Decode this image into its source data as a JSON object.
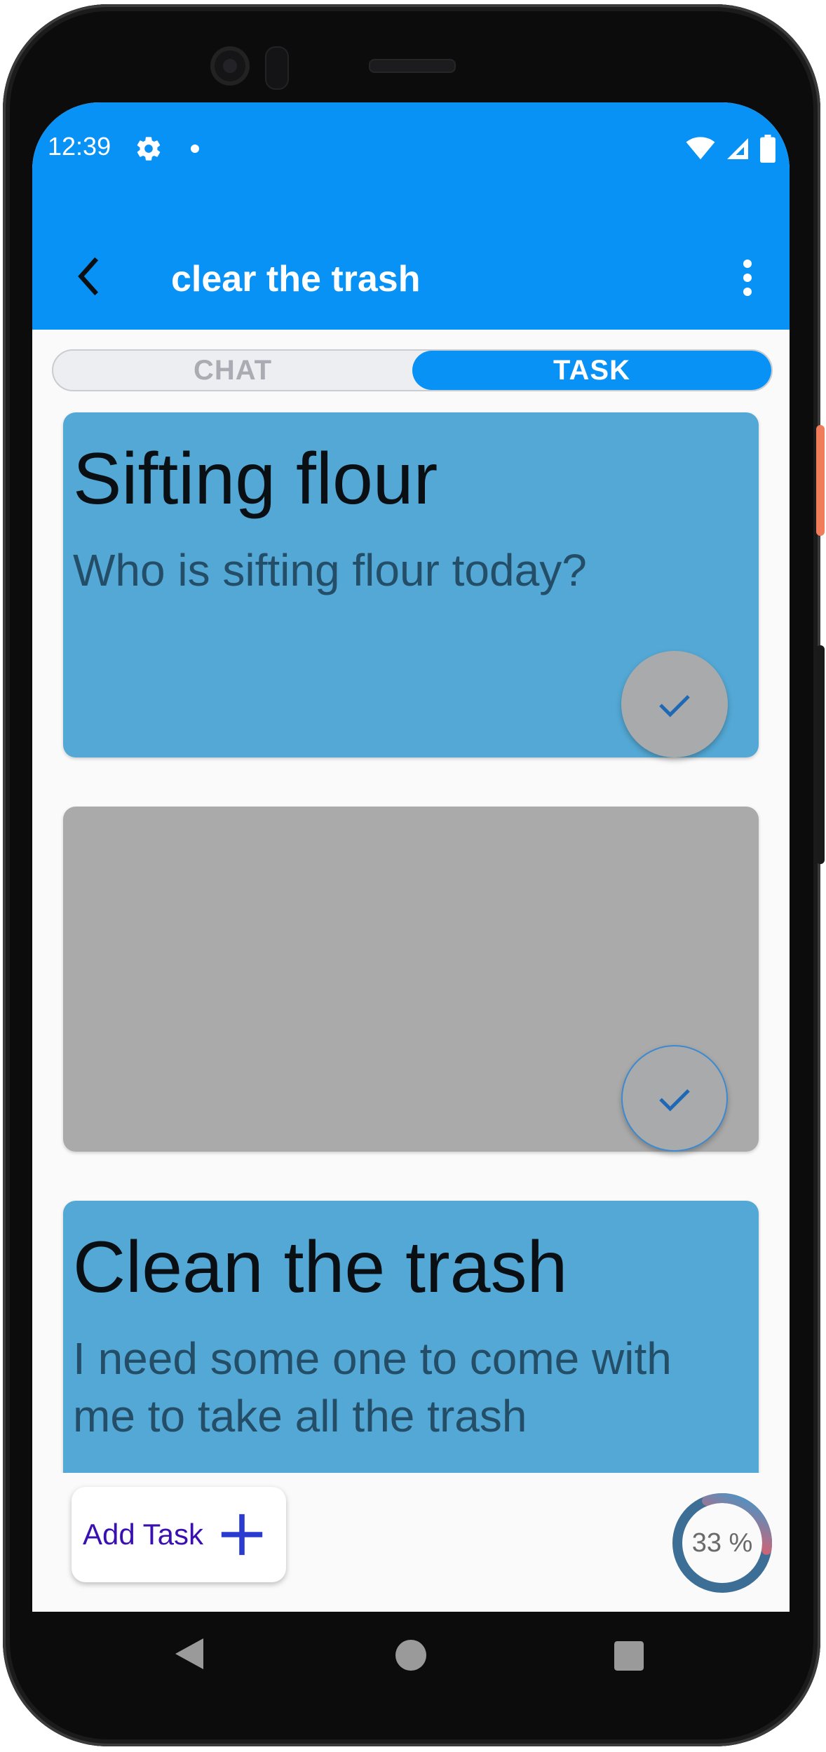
{
  "status_bar": {
    "time": "12:39"
  },
  "app_bar": {
    "title": "clear the trash"
  },
  "tabs": [
    {
      "label": "CHAT",
      "active": false
    },
    {
      "label": "TASK",
      "active": true
    }
  ],
  "tasks": [
    {
      "title": "Sifting flour",
      "description": "Who is sifting flour today?",
      "color": "#53a8d5"
    },
    {
      "title": "",
      "description": "",
      "color": "#aaaaaa"
    },
    {
      "title": "Clean the trash",
      "description": "I need some one to come with me to take all the trash",
      "color": "#53a8d5"
    }
  ],
  "add_task": {
    "label": "Add Task"
  },
  "progress": {
    "value": 33,
    "text": "33 %"
  },
  "colors": {
    "primary": "#0892f5",
    "card": "#53a8d5",
    "card_inactive": "#aaaaaa",
    "add_label": "#3a10b0"
  }
}
